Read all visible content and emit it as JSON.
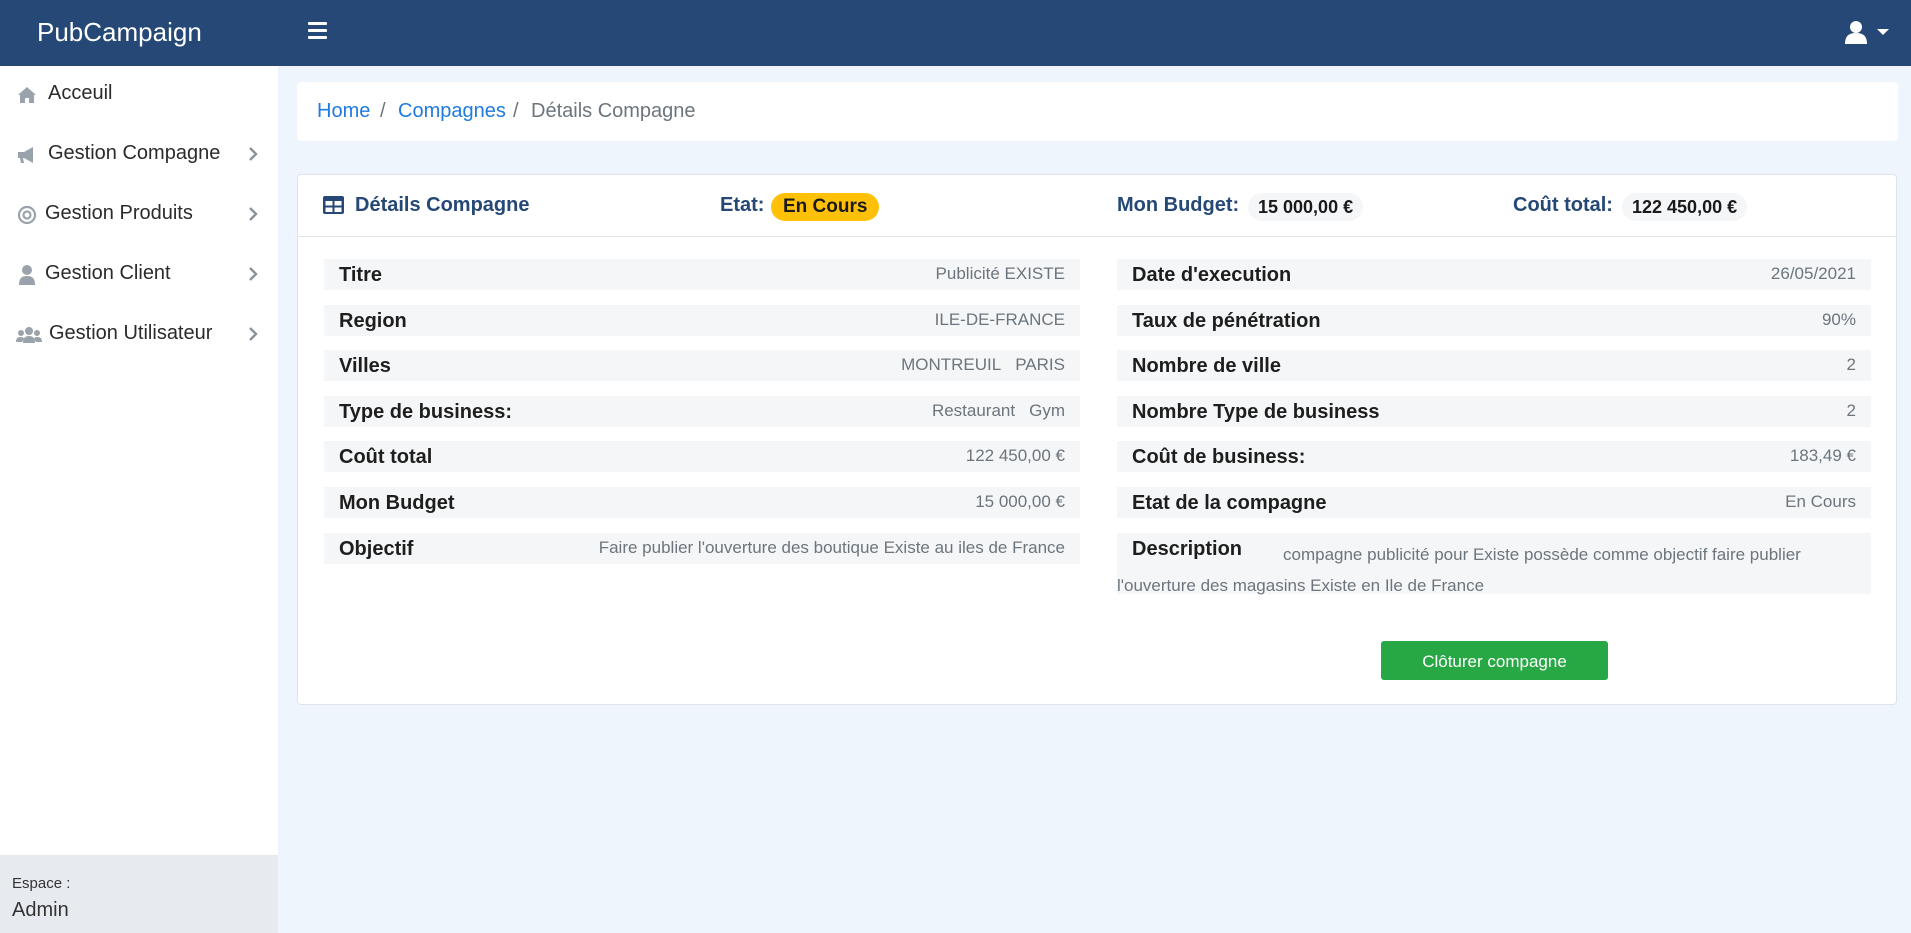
{
  "app": {
    "brand": "PubCampaign"
  },
  "sidebar": {
    "items": [
      {
        "label": "Acceuil",
        "icon": "home-icon"
      },
      {
        "label": "Gestion Compagne",
        "icon": "bullhorn-icon"
      },
      {
        "label": "Gestion Produits",
        "icon": "bullseye-icon"
      },
      {
        "label": "Gestion Client",
        "icon": "user-icon"
      },
      {
        "label": "Gestion Utilisateur",
        "icon": "users-icon"
      }
    ],
    "footer": {
      "label": "Espace :",
      "value": "Admin"
    }
  },
  "breadcrumb": {
    "home": "Home",
    "sep1": "/",
    "compagnes": "Compagnes",
    "sep2": "/",
    "current": "Détails Compagne"
  },
  "card": {
    "title": "Détails Compagne",
    "etat_label": "Etat:",
    "etat_value": "En Cours",
    "budget_label": "Mon Budget:",
    "budget_value": "15 000,00 €",
    "cout_label": "Coût total:",
    "cout_value": "122 450,00 €"
  },
  "details": {
    "left": [
      {
        "label": "Titre",
        "value": "Publicité EXISTE"
      },
      {
        "label": "Region",
        "value": "ILE-DE-FRANCE"
      },
      {
        "label": "Villes",
        "values": [
          "MONTREUIL",
          "PARIS"
        ]
      },
      {
        "label": "Type de business:",
        "values": [
          "Restaurant",
          "Gym"
        ]
      },
      {
        "label": "Coût total",
        "value": "122 450,00 €"
      },
      {
        "label": "Mon Budget",
        "value": "15 000,00 €"
      },
      {
        "label": "Objectif",
        "value": "Faire publier l'ouverture des boutique Existe au iles de France"
      }
    ],
    "right": [
      {
        "label": "Date d'execution",
        "value": "26/05/2021"
      },
      {
        "label": "Taux de pénétration",
        "value": "90%"
      },
      {
        "label": "Nombre de ville",
        "value": "2"
      },
      {
        "label": "Nombre Type de business",
        "value": "2"
      },
      {
        "label": "Coût de business:",
        "value": "183,49 €"
      },
      {
        "label": "Etat de la compagne",
        "value": "En Cours"
      }
    ],
    "description": {
      "label": "Description",
      "value": "compagne publicité pour Existe possède comme objectif faire publier l'ouverture des magasins Existe en Ile de France"
    }
  },
  "actions": {
    "close_label": "Clôturer compagne"
  },
  "colors": {
    "navbar": "#254876",
    "accent": "#1f7be0",
    "badge_warning": "#ffc107",
    "button_success": "#28a745",
    "page_bg": "#eef5fc"
  }
}
